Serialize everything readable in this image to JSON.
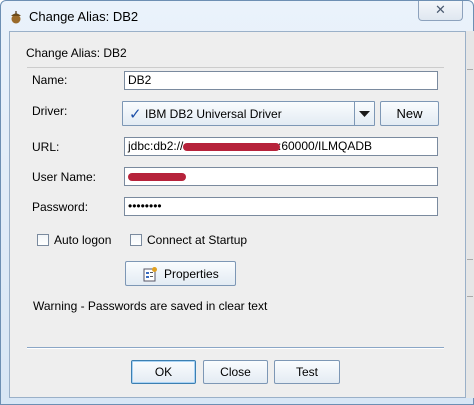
{
  "window": {
    "title": "Change Alias: DB2",
    "close_glyph": "✕"
  },
  "dialog": {
    "heading": "Change Alias: DB2"
  },
  "form": {
    "name_label": "Name:",
    "name_value": "DB2",
    "driver_label": "Driver:",
    "driver_check": "✓",
    "driver_value": "IBM DB2 Universal Driver",
    "new_button": "New",
    "url_label": "URL:",
    "url_prefix": "jdbc:db2://",
    "url_suffix": ":60000/ILMQADB",
    "username_label": "User Name:",
    "password_label": "Password:",
    "password_value": "••••••••"
  },
  "options": {
    "auto_logon": "Auto logon",
    "auto_logon_checked": false,
    "connect_startup": "Connect at Startup",
    "connect_startup_checked": false
  },
  "properties_button": "Properties",
  "warning": "Warning - Passwords are saved in clear text",
  "footer": {
    "ok": "OK",
    "close": "Close",
    "test": "Test"
  },
  "colors": {
    "check_mark": "#1c4fa8",
    "redaction": "#b0102a",
    "title_bg": "#dce8f5"
  },
  "icons": {
    "app": "acorn-icon",
    "properties": "properties-icon",
    "dropdown": "chevron-down-icon"
  }
}
